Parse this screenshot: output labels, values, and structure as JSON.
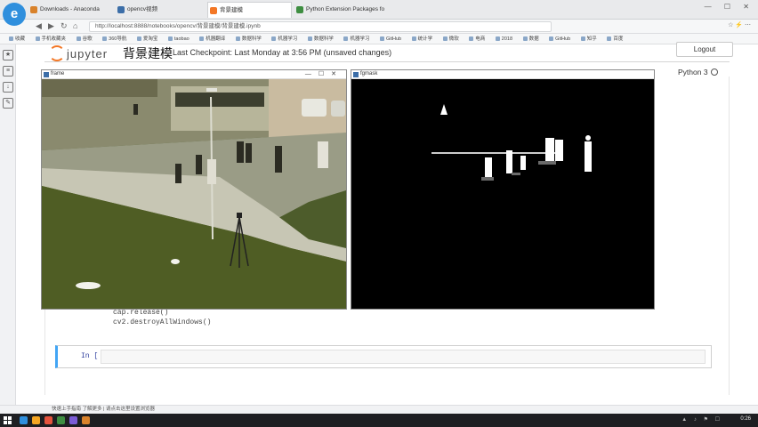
{
  "browser": {
    "logo_letter": "e",
    "tabs": [
      {
        "label": "Downloads - Anaconda",
        "active": false
      },
      {
        "label": "opencv视频",
        "active": false
      },
      {
        "label": "背景建模",
        "active": true
      },
      {
        "label": "Python Extension Packages fo",
        "active": false
      }
    ],
    "url": "http://localhost:8888/notebooks/opencv/背景建模/背景建模.ipynb",
    "bookmarks": [
      "收藏",
      "手机收藏夹",
      "谷歌",
      "360导航",
      "爱淘宝",
      "taobao",
      "机器翻译",
      "数据科学",
      "机器学习",
      "数据科学",
      "机器学习",
      "GitHub",
      "统计学",
      "微软",
      "电商",
      "2018",
      "数据",
      "GitHub",
      "知乎",
      "百度",
      "学习",
      "问答"
    ]
  },
  "jupyter": {
    "logo_text": "jupyter",
    "notebook_title": "背景建模",
    "checkpoint": "Last Checkpoint: Last Monday at 3:56 PM (unsaved changes)",
    "logout_label": "Logout",
    "kernel_name": "Python 3"
  },
  "code": {
    "line1": "cap.release()",
    "line2": "cv2.destroyAllWindows()",
    "empty_prompt": "In [ ]:"
  },
  "windows": {
    "frame_title": "frame",
    "mask_title": "fgmask"
  },
  "statusbar": {
    "text": "快速上手指南 了解更多 | 请点击这里设置浏览器"
  },
  "taskbar": {
    "time": "0:26",
    "apps": [
      "#2f8fdd",
      "#f5a623",
      "#e5533d",
      "#3e8e41",
      "#7b5cd6",
      "#d9822b"
    ]
  },
  "colors": {
    "jupyter_orange": "#f37726",
    "cell_accent": "#42a5f5"
  }
}
